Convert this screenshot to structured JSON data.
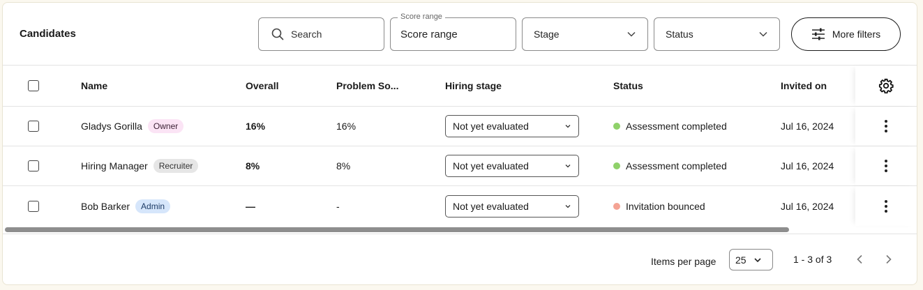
{
  "header": {
    "title": "Candidates",
    "search_placeholder": "Search",
    "score_range_label": "Score range",
    "score_range_value": "Score range",
    "stage_label": "Stage",
    "status_label": "Status",
    "more_filters_label": "More filters"
  },
  "table": {
    "columns": {
      "name": "Name",
      "overall": "Overall",
      "problem_solving": "Problem So...",
      "hiring_stage": "Hiring stage",
      "status": "Status",
      "invited_on": "Invited on"
    },
    "rows": [
      {
        "name": "Gladys Gorilla",
        "role": "Owner",
        "overall": "16%",
        "problem_solving": "16%",
        "hiring_stage": "Not yet evaluated",
        "status": "Assessment completed",
        "status_color": "#8fd16a",
        "invited_on": "Jul 16, 2024"
      },
      {
        "name": "Hiring Manager",
        "role": "Recruiter",
        "overall": "8%",
        "problem_solving": "8%",
        "hiring_stage": "Not yet evaluated",
        "status": "Assessment completed",
        "status_color": "#8fd16a",
        "invited_on": "Jul 16, 2024"
      },
      {
        "name": "Bob Barker",
        "role": "Admin",
        "overall": "—",
        "problem_solving": "-",
        "hiring_stage": "Not yet evaluated",
        "status": "Invitation bounced",
        "status_color": "#f4a394",
        "invited_on": "Jul 16, 2024"
      }
    ]
  },
  "footer": {
    "items_per_page_label": "Items per page",
    "items_per_page_value": "25",
    "range_text": "1 - 3 of 3"
  },
  "colors": {
    "page_bg": "#fbf8ef",
    "owner_badge": "#fbe4f5",
    "recruiter_badge": "#e6e6e6",
    "admin_badge": "#d6e6fb",
    "completed_dot": "#8fd16a",
    "bounced_dot": "#f4a394"
  }
}
